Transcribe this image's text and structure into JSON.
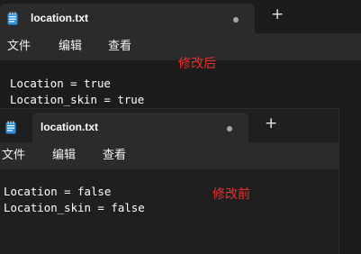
{
  "colors": {
    "annotation": "#e5322d",
    "tab_background": "#2b2b2b",
    "editor_background": "#1c1c1c"
  },
  "window_after": {
    "tab_title": "location.txt",
    "tab_icon": "notepad-icon",
    "tab_status": "unsaved-dot",
    "new_tab": "+",
    "menu": [
      "文件",
      "编辑",
      "查看"
    ],
    "lines": [
      "Location = true",
      "Location_skin = true"
    ],
    "annotation": "修改后"
  },
  "window_before": {
    "tab_title": "location.txt",
    "tab_icon": "notepad-icon",
    "tab_status": "unsaved-dot",
    "new_tab": "+",
    "menu": [
      "文件",
      "编辑",
      "查看"
    ],
    "lines": [
      "Location = false",
      "Location_skin = false"
    ],
    "annotation": "修改前"
  }
}
